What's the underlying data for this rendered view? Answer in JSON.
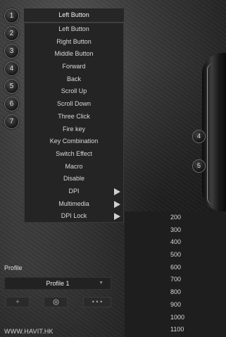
{
  "button_numbers": [
    "1",
    "2",
    "3",
    "4",
    "5",
    "6",
    "7"
  ],
  "selected_function": "Left Button",
  "menu": {
    "items": [
      {
        "label": "Left Button"
      },
      {
        "label": "Right Button"
      },
      {
        "label": "Middle Button"
      },
      {
        "label": "Forward"
      },
      {
        "label": "Back"
      },
      {
        "label": "Scroll Up"
      },
      {
        "label": "Scroll Down"
      },
      {
        "label": "Three Click"
      },
      {
        "label": "Fire key"
      },
      {
        "label": "Key Combination"
      },
      {
        "label": "Switch Effect"
      },
      {
        "label": "Macro"
      },
      {
        "label": "Disable"
      },
      {
        "label": "DPI",
        "submenu": true
      },
      {
        "label": "Multimedia",
        "submenu": true
      },
      {
        "label": "DPI Lock",
        "submenu": true
      }
    ]
  },
  "dpi_submenu": [
    "200",
    "300",
    "400",
    "500",
    "600",
    "700",
    "800",
    "900",
    "1000",
    "1100"
  ],
  "mouse_markers": [
    "4",
    "5"
  ],
  "profile": {
    "label": "Profile",
    "selected": "Profile 1",
    "add_icon": "+",
    "delete_icon": "trash-icon",
    "more_icon": "more-icon",
    "more_text": "• • •"
  },
  "website": "WWW.HAVIT.HK",
  "icons": {
    "submenu_arrow": "triangle-right-icon",
    "dropdown_caret": "triangle-down-icon"
  }
}
